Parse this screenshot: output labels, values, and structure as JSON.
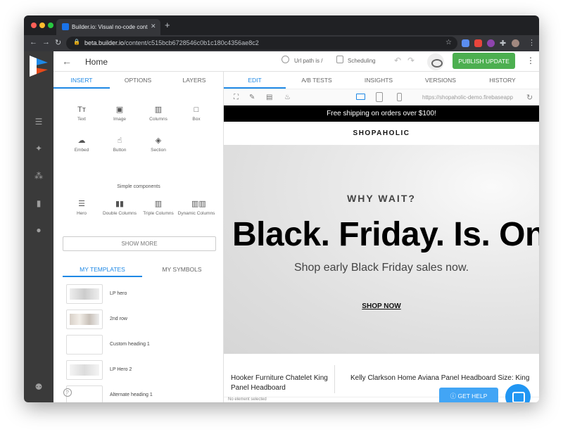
{
  "browser": {
    "tab_title": "Builder.io: Visual no-code cont",
    "url_host": "beta.builder.io",
    "url_path": "/content/c515bcb6728546c0b1c180c4356ae8c2"
  },
  "header": {
    "page_title": "Home",
    "url_path_label": "Url path is /",
    "scheduling_label": "Scheduling",
    "publish_label": "PUBLISH UPDATE"
  },
  "panel": {
    "tabs": [
      {
        "label": "INSERT"
      },
      {
        "label": "OPTIONS"
      },
      {
        "label": "LAYERS"
      }
    ],
    "components": [
      {
        "label": "Text",
        "icon": "text-icon",
        "glyph": "Tт"
      },
      {
        "label": "Image",
        "icon": "image-icon",
        "glyph": "▣"
      },
      {
        "label": "Columns",
        "icon": "columns-icon",
        "glyph": "▥"
      },
      {
        "label": "Box",
        "icon": "box-icon",
        "glyph": "□"
      },
      {
        "label": "Embed",
        "icon": "cloud-icon",
        "glyph": "☁"
      },
      {
        "label": "Button",
        "icon": "hand-icon",
        "glyph": "☝"
      },
      {
        "label": "Section",
        "icon": "layers-icon",
        "glyph": "◈"
      }
    ],
    "simple_components_label": "Simple components",
    "simple_components": [
      {
        "label": "Hero",
        "icon": "hero-icon",
        "glyph": "☰"
      },
      {
        "label": "Double Columns",
        "icon": "double-columns-icon",
        "glyph": "▮▮"
      },
      {
        "label": "Triple Columns",
        "icon": "triple-columns-icon",
        "glyph": "▥"
      },
      {
        "label": "Dynamic Columns",
        "icon": "dynamic-columns-icon",
        "glyph": "▥▥"
      }
    ],
    "show_more_label": "SHOW MORE",
    "template_tabs": [
      {
        "label": "MY TEMPLATES"
      },
      {
        "label": "MY SYMBOLS"
      }
    ],
    "templates": [
      {
        "label": "LP hero"
      },
      {
        "label": "2nd row"
      },
      {
        "label": "Custom heading 1"
      },
      {
        "label": "LP Hero 2"
      },
      {
        "label": "Alternate heading 1"
      }
    ]
  },
  "main": {
    "tabs": [
      {
        "label": "EDIT"
      },
      {
        "label": "A/B TESTS"
      },
      {
        "label": "INSIGHTS"
      },
      {
        "label": "VERSIONS"
      },
      {
        "label": "HISTORY"
      }
    ],
    "preview_url": "https://shopaholic-demo.firebaseapp",
    "status_text": "No element selected"
  },
  "canvas": {
    "promo_text": "Free shipping on orders over $100!",
    "brand": "SHOPAHOLIC",
    "hero_kicker": "WHY WAIT?",
    "hero_title": "Black. Friday. Is. On",
    "hero_subtitle": "Shop early Black Friday sales now.",
    "hero_cta": "SHOP NOW",
    "products": [
      {
        "name": "Hooker Furniture Chatelet King Panel Headboard"
      },
      {
        "name": "Kelly Clarkson Home Aviana Panel Headboard Size: King"
      }
    ]
  },
  "help": {
    "get_help_label": "GET HELP"
  },
  "colors": {
    "accent": "#1e88e5",
    "publish": "#4caf50",
    "rail": "#3a3a3a"
  }
}
